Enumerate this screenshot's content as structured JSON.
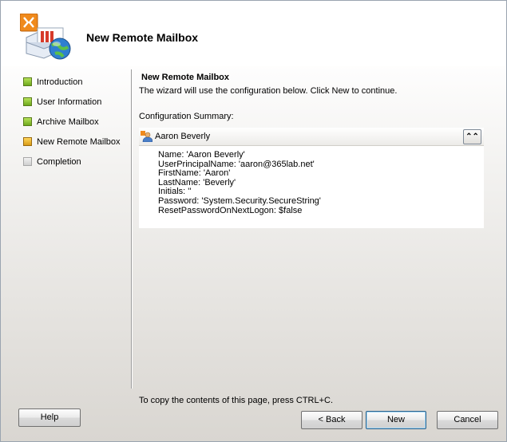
{
  "header": {
    "title": "New Remote Mailbox",
    "icon": "exchange-mailbox-globe-icon"
  },
  "nav": {
    "items": [
      {
        "label": "Introduction",
        "state": "completed"
      },
      {
        "label": "User Information",
        "state": "completed"
      },
      {
        "label": "Archive Mailbox",
        "state": "completed"
      },
      {
        "label": "New Remote Mailbox",
        "state": "current"
      },
      {
        "label": "Completion",
        "state": "pending"
      }
    ]
  },
  "content": {
    "title": "New Remote Mailbox",
    "description": "The wizard will use the configuration below.  Click New to continue.",
    "summary_label": "Configuration Summary:",
    "summary": {
      "name": "Aaron Beverly",
      "lines": [
        "Name: 'Aaron Beverly'",
        "UserPrincipalName: 'aaron@365lab.net'",
        "FirstName: 'Aaron'",
        "LastName: 'Beverly'",
        "Initials: ''",
        "Password: 'System.Security.SecureString'",
        "ResetPasswordOnNextLogon: $false"
      ]
    }
  },
  "footer": {
    "copy_hint": "To copy the contents of this page, press CTRL+C.",
    "help_label": "Help",
    "back_label": "< Back",
    "new_label": "New",
    "cancel_label": "Cancel"
  },
  "colors": {
    "completed": "#7cb82a",
    "current": "#f0b428",
    "pending": "#d0d0d0"
  }
}
